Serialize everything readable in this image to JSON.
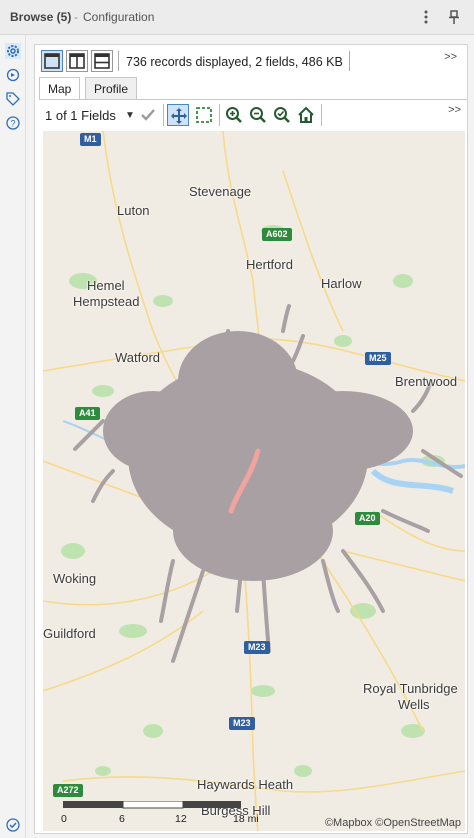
{
  "window": {
    "title": "Browse (5)",
    "separator": "-",
    "subtitle": "Configuration",
    "menu_icon": "kebab-icon",
    "pin_icon": "pin-icon"
  },
  "rail": {
    "icons": [
      "gear-icon",
      "config-target-icon",
      "tag-icon",
      "help-icon",
      "checkmark-circle-icon"
    ]
  },
  "results": {
    "records_text": "736 records displayed, 2 fields, 486 KB",
    "expand_mark": ">>",
    "tabs": [
      {
        "label": "Map",
        "active": true
      },
      {
        "label": "Profile",
        "active": false
      }
    ]
  },
  "map_toolbar": {
    "fields_value": "1 of 1 Fields",
    "expand_mark": ">>"
  },
  "map": {
    "places": [
      {
        "name": "Stevenage"
      },
      {
        "name": "Luton"
      },
      {
        "name": "Hertford"
      },
      {
        "name": "Hemel"
      },
      {
        "name": "Hempstead"
      },
      {
        "name": "Harlow"
      },
      {
        "name": "Watford"
      },
      {
        "name": "Brentwood"
      },
      {
        "name": "Woking"
      },
      {
        "name": "Guildford"
      },
      {
        "name": "Royal Tunbridge"
      },
      {
        "name": "Wells"
      },
      {
        "name": "Haywards Heath"
      },
      {
        "name": "Burgess Hill"
      }
    ],
    "roads": [
      {
        "label": "M1",
        "color": "blue"
      },
      {
        "label": "A602",
        "color": "green"
      },
      {
        "label": "M25",
        "color": "blue"
      },
      {
        "label": "A41",
        "color": "green"
      },
      {
        "label": "A20",
        "color": "green"
      },
      {
        "label": "M23",
        "color": "blue"
      },
      {
        "label": "M23",
        "color": "blue"
      },
      {
        "label": "A272",
        "color": "green"
      }
    ],
    "scale": {
      "ticks": [
        "0",
        "6",
        "12",
        "18 mi"
      ]
    },
    "attribution": "©Mapbox ©OpenStreetMap",
    "colors": {
      "land": "#f1ece3",
      "water": "#a9d3f2",
      "park": "#bfe3b0",
      "routes": "#a9a0a3",
      "highlight": "#f2a3a0",
      "road": "#f7d98a"
    }
  }
}
